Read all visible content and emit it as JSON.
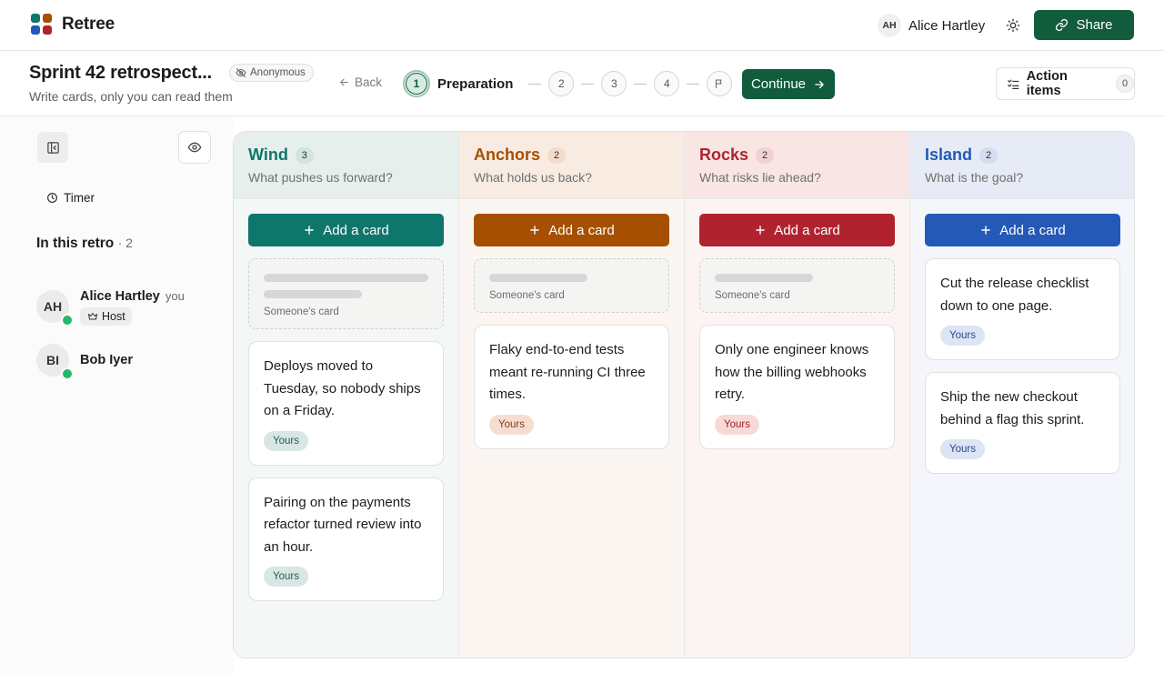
{
  "app": {
    "name": "Retree",
    "share_label": "Share"
  },
  "user": {
    "initials": "AH",
    "name": "Alice Hartley"
  },
  "retro": {
    "title": "Sprint 42 retrospect...",
    "badge": "Anonymous",
    "subtitle": "Write cards, only you can read them",
    "back_label": "Back",
    "steps": {
      "active_number": "1",
      "active_label": "Preparation",
      "s2": "2",
      "s3": "3",
      "s4": "4"
    },
    "continue_label": "Continue",
    "action_items_label": "Action items",
    "action_items_count": "0"
  },
  "sidebar": {
    "timer_label": "Timer",
    "section_title": "In this retro",
    "section_count": "· 2",
    "participants": [
      {
        "initials": "AH",
        "name": "Alice Hartley",
        "you": "you",
        "badge": "Host"
      },
      {
        "initials": "BI",
        "name": "Bob Iyer"
      }
    ]
  },
  "columns": [
    {
      "title": "Wind",
      "count": "3",
      "subtitle": "What pushes us forward?",
      "add_label": "Add a card",
      "colors": {
        "accent": "#0e766a",
        "header_bg": "#e7efed",
        "count_bg": "#d2e4df",
        "body_bg": "#f3f7f6",
        "pill_bg": "#d8e7e4",
        "pill_text": "#1e5f55"
      },
      "hidden_label": "Someone's card",
      "cards": [
        {
          "text": "Deploys moved to Tuesday, so nobody ships on a Friday.",
          "tag": "Yours"
        },
        {
          "text": "Pairing on the payments refactor turned review into an hour.",
          "tag": "Yours"
        }
      ]
    },
    {
      "title": "Anchors",
      "count": "2",
      "subtitle": "What holds us back?",
      "add_label": "Add a card",
      "colors": {
        "accent": "#a64f00",
        "header_bg": "#f8ebe2",
        "count_bg": "#f3dccb",
        "body_bg": "#fcf6f2",
        "pill_bg": "#f6ddd2",
        "pill_text": "#8a3d12"
      },
      "hidden_label": "Someone's card",
      "cards": [
        {
          "text": "Flaky end-to-end tests meant re-running CI three times.",
          "tag": "Yours"
        }
      ]
    },
    {
      "title": "Rocks",
      "count": "2",
      "subtitle": "What risks lie ahead?",
      "add_label": "Add a card",
      "colors": {
        "accent": "#b0232e",
        "header_bg": "#f9e6e4",
        "count_bg": "#f2d2d1",
        "body_bg": "#fcf4f3",
        "pill_bg": "#f7dad8",
        "pill_text": "#9a2128"
      },
      "hidden_label": "Someone's card",
      "cards": [
        {
          "text": "Only one engineer knows how the billing webhooks retry.",
          "tag": "Yours"
        }
      ]
    },
    {
      "title": "Island",
      "count": "2",
      "subtitle": "What is the goal?",
      "add_label": "Add a card",
      "colors": {
        "accent": "#2459b8",
        "header_bg": "#e6ebf5",
        "count_bg": "#d4def1",
        "body_bg": "#f4f6fb",
        "pill_bg": "#dde4f4",
        "pill_text": "#2a4a8d"
      },
      "cards": [
        {
          "text": "Cut the release checklist down to one page.",
          "tag": "Yours"
        },
        {
          "text": "Ship the new checkout behind a flag this sprint.",
          "tag": "Yours"
        }
      ]
    }
  ],
  "icons": {
    "logo": "retree-logo-icon",
    "theme": "sun-icon",
    "share": "link-icon",
    "back": "arrow-left-icon",
    "flag": "flag-icon",
    "continue": "arrow-right-icon",
    "action_items": "checklist-icon",
    "collapse": "panel-collapse-icon",
    "visibility": "eye-icon",
    "timer": "clock-icon",
    "host": "crown-icon",
    "add": "plus-icon"
  }
}
